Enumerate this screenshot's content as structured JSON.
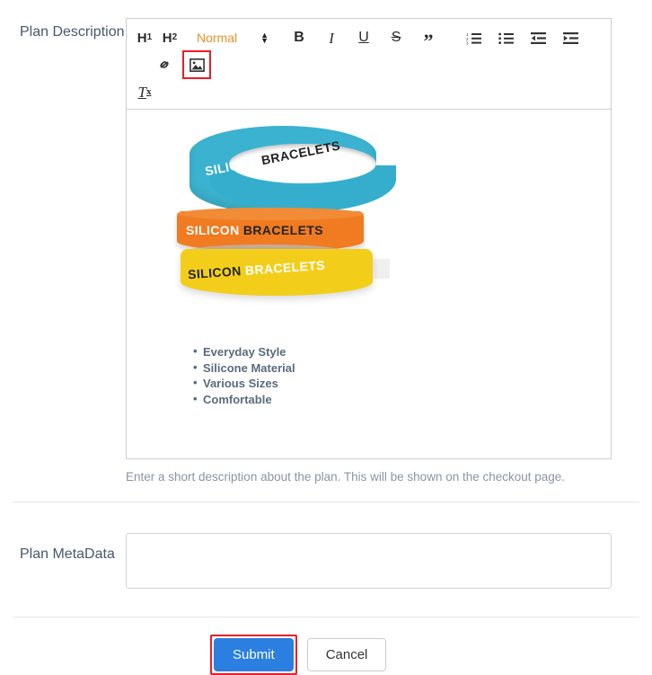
{
  "form": {
    "description_row": {
      "label": "Plan Description",
      "help_text": "Enter a short description about the plan. This will be shown on the checkout page."
    },
    "metadata_row": {
      "label": "Plan MetaData",
      "value": "",
      "placeholder": ""
    }
  },
  "editor": {
    "toolbar": {
      "heading1": "H",
      "heading1_sub": "1",
      "heading2": "H",
      "heading2_sub": "2",
      "format_picker_value": "Normal",
      "format_picker_color": "#e8912a",
      "bold": "B",
      "italic": "I",
      "underline": "U",
      "strikethrough": "S",
      "blockquote": "”",
      "clear_format": "T",
      "clear_format_sub": "x",
      "ordered_list_title": "Ordered list",
      "bullet_list_title": "Bullet list",
      "outdent_title": "Decrease indent",
      "indent_title": "Increase indent",
      "link_title": "Insert link",
      "image_title": "Insert image"
    },
    "content": {
      "image_alt": "Three stacked silicone bracelets",
      "bands": [
        {
          "color": "#3bb3d0",
          "word1": "SILICON",
          "word2": "BRACELETS"
        },
        {
          "color": "#f07b21",
          "word1": "SILICON",
          "word2": "BRACELETS"
        },
        {
          "color": "#f2ce1b",
          "word1": "SILICON",
          "word2": "BRACELETS"
        }
      ],
      "features": [
        "Everyday Style",
        "Silicone Material",
        "Various Sizes",
        "Comfortable"
      ]
    }
  },
  "actions": {
    "submit_label": "Submit",
    "cancel_label": "Cancel"
  },
  "annotations": {
    "highlight_color": "#ee1c25",
    "highlighted": [
      "image-button",
      "submit-button"
    ]
  }
}
